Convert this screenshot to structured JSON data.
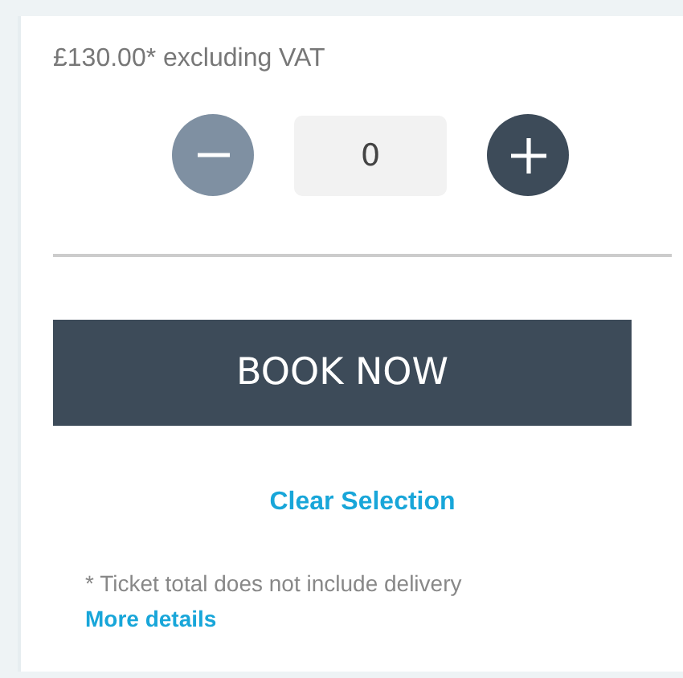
{
  "price": {
    "text": "£130.00* excluding VAT"
  },
  "quantity": {
    "value": "0",
    "decrease_disabled": true,
    "increase_disabled": false
  },
  "book_button": {
    "label": "BOOK NOW"
  },
  "clear_link": {
    "label": "Clear Selection"
  },
  "footnote": {
    "text": "* Ticket total does not include delivery",
    "link": "More details"
  }
}
